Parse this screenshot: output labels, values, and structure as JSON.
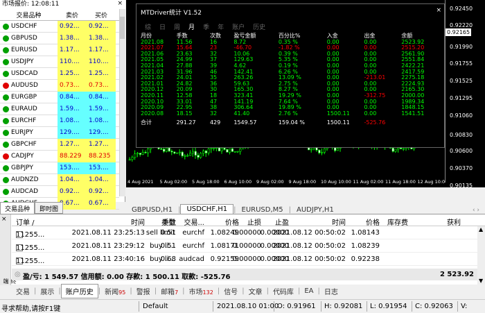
{
  "market_watch": {
    "title": "市场报价: 12:08:11",
    "close": "×",
    "columns": [
      "交易品种",
      "卖价",
      "买价"
    ],
    "rows": [
      {
        "symbol": "USDCHF",
        "bid": "0.92...",
        "ask": "0.92...",
        "bg": "#ffff66",
        "dir": "up"
      },
      {
        "symbol": "GBPUSD",
        "bid": "1.38...",
        "ask": "1.38...",
        "bg": "#ffff66",
        "dir": "up"
      },
      {
        "symbol": "EURUSD",
        "bid": "1.17...",
        "ask": "1.17...",
        "bg": "#ffff66",
        "dir": "up"
      },
      {
        "symbol": "USDJPY",
        "bid": "110....",
        "ask": "110....",
        "bg": "#ffff66",
        "dir": "up"
      },
      {
        "symbol": "USDCAD",
        "bid": "1.25...",
        "ask": "1.25...",
        "bg": "#ffff66",
        "dir": "up"
      },
      {
        "symbol": "AUDUSD",
        "bid": "0.73...",
        "ask": "0.73...",
        "bg": "#ffff66",
        "dir": "down"
      },
      {
        "symbol": "EURGBP",
        "bid": "0.84...",
        "ask": "0.84...",
        "bg": "#66ffff",
        "dir": "up"
      },
      {
        "symbol": "EURAUD",
        "bid": "1.59...",
        "ask": "1.59...",
        "bg": "#66ffff",
        "dir": "up"
      },
      {
        "symbol": "EURCHF",
        "bid": "1.08...",
        "ask": "1.08...",
        "bg": "#66ffff",
        "dir": "up"
      },
      {
        "symbol": "EURJPY",
        "bid": "129....",
        "ask": "129....",
        "bg": "#66ffff",
        "dir": "up"
      },
      {
        "symbol": "GBPCHF",
        "bid": "1.27...",
        "ask": "1.27...",
        "bg": "#ffff66",
        "dir": "up"
      },
      {
        "symbol": "CADJPY",
        "bid": "88.229",
        "ask": "88.235",
        "bg": "#ffff66",
        "dir": "down"
      },
      {
        "symbol": "GBPJPY",
        "bid": "153....",
        "ask": "153....",
        "bg": "#66ffff",
        "dir": "up"
      },
      {
        "symbol": "AUDNZD",
        "bid": "1.04...",
        "ask": "1.04...",
        "bg": "#ffff66",
        "dir": "up"
      },
      {
        "symbol": "AUDCAD",
        "bid": "0.92...",
        "ask": "0.92...",
        "bg": "#ffff66",
        "dir": "up"
      },
      {
        "symbol": "AUDCHF",
        "bid": "0.67...",
        "ask": "0.67...",
        "bg": "#ffff66",
        "dir": "up"
      }
    ],
    "tabs": [
      "交易品种",
      "即时图"
    ]
  },
  "indicator": {
    "title": "MTDriver统计 V1.52",
    "periods": [
      "综",
      "日",
      "周",
      "月",
      "季",
      "年",
      "账户",
      "历史"
    ],
    "active_period": "月",
    "columns": [
      "月份",
      "手数",
      "次数",
      "盈亏金额",
      "百分比%",
      "入金",
      "出金",
      "余额"
    ],
    "rows": [
      [
        "2021.08",
        "11.56",
        "16",
        "8.72",
        "0.35 %",
        "0.00",
        "0.00",
        "2523.92"
      ],
      [
        "2021.07",
        "15.64",
        "23",
        "-46.70",
        "-1.82 %",
        "0.00",
        "0.00",
        "2515.20"
      ],
      [
        "2021.06",
        "23.63",
        "32",
        "10.06",
        "0.39 %",
        "0.00",
        "0.00",
        "2561.90"
      ],
      [
        "2021.05",
        "24.99",
        "37",
        "129.63",
        "5.35 %",
        "0.00",
        "0.00",
        "2551.84"
      ],
      [
        "2021.04",
        "27.88",
        "39",
        "4.62",
        "0.19 %",
        "0.00",
        "0.00",
        "2422.21"
      ],
      [
        "2021.03",
        "31.96",
        "46",
        "142.41",
        "6.26 %",
        "0.00",
        "0.00",
        "2417.59"
      ],
      [
        "2021.02",
        "24.01",
        "35",
        "263.26",
        "13.09 %",
        "0.00",
        "-213.01",
        "2275.18"
      ],
      [
        "2021.01",
        "24.82",
        "36",
        "59.63",
        "2.75 %",
        "0.00",
        "0.00",
        "2224.93"
      ],
      [
        "2020.12",
        "20.09",
        "30",
        "165.30",
        "8.27 %",
        "0.00",
        "0.00",
        "2165.30"
      ],
      [
        "2020.11",
        "12.58",
        "18",
        "323.41",
        "19.29 %",
        "0.00",
        "-312.75",
        "2000.00"
      ],
      [
        "2020.10",
        "33.01",
        "47",
        "141.19",
        "7.64 %",
        "0.00",
        "0.00",
        "1989.34"
      ],
      [
        "2020.09",
        "22.95",
        "38",
        "306.64",
        "19.89 %",
        "0.00",
        "0.00",
        "1848.15"
      ],
      [
        "2020.08",
        "18.15",
        "32",
        "41.40",
        "2.76 %",
        "1500.11",
        "0.00",
        "1541.51"
      ]
    ],
    "total": [
      "合计",
      "291.27",
      "429",
      "1549.57",
      "159.04 %",
      "1500.11",
      "-525.76",
      ""
    ]
  },
  "price_axis": [
    "0.92450",
    "0.92220",
    "0.92165",
    "0.91990",
    "0.91755",
    "0.91525",
    "0.91295",
    "0.91060",
    "0.90830",
    "0.90600",
    "0.90370",
    "0.90135"
  ],
  "time_axis": [
    "4 Aug 2021",
    "5 Aug 02:00",
    "5 Aug 18:00",
    "6 Aug 10:00",
    "9 Aug 02:00",
    "9 Aug 18:00",
    "10 Aug 10:00",
    "11 Aug 02:00",
    "11 Aug 18:00",
    "12 Aug 10:00"
  ],
  "chart_tabs": [
    "GBPUSD,H1",
    "USDCHF,H1",
    "EURUSD,M5",
    "AUDJPY,H1"
  ],
  "active_chart_tab": "USDCHF,H1",
  "terminal": {
    "columns": [
      "订单 /",
      "时间",
      "类型",
      "手数",
      "交易...",
      "价格",
      "止损",
      "止盈",
      "时间",
      "价格",
      "库存费",
      "获利"
    ],
    "rows": [
      [
        "11255...",
        "2021.08.11 23:25:13",
        "sell limit",
        "0.51",
        "eurchf",
        "1.08249",
        "0.00000",
        "0.00000",
        "2021.08.12 00:50:02",
        "1.08143",
        "",
        ""
      ],
      [
        "11255...",
        "2021.08.11 23:29:12",
        "buy li...",
        "0.51",
        "eurchf",
        "1.08171",
        "0.00000",
        "0.00000",
        "2021.08.12 00:50:02",
        "1.08239",
        "",
        ""
      ],
      [
        "11255...",
        "2021.08.11 23:40:16",
        "buy li...",
        "0.68",
        "audcad",
        "0.92159",
        "0.00000",
        "0.00000",
        "2021.08.12 00:50:02",
        "0.92238",
        "",
        ""
      ]
    ],
    "summary": "盈/亏: 1 549.57 信用额: 0.00 存款: 1 500.11 取款: -525.76",
    "summary_total": "2 523.92",
    "side_label": "终端"
  },
  "bottom_tabs": [
    {
      "label": "交易",
      "badge": ""
    },
    {
      "label": "展示",
      "badge": ""
    },
    {
      "label": "账户历史",
      "badge": ""
    },
    {
      "label": "新闻",
      "badge": "95"
    },
    {
      "label": "警报",
      "badge": ""
    },
    {
      "label": "邮箱",
      "badge": "7"
    },
    {
      "label": "市场",
      "badge": "132"
    },
    {
      "label": "信号",
      "badge": ""
    },
    {
      "label": "文章",
      "badge": ""
    },
    {
      "label": "代码库",
      "badge": ""
    },
    {
      "label": "EA",
      "badge": ""
    },
    {
      "label": "日志",
      "badge": ""
    }
  ],
  "active_bottom_tab": "账户历史",
  "status": {
    "help": "寻求帮助,请按F1键",
    "profile": "Default",
    "time": "2021.08.10 01:00",
    "open": "O: 0.91961",
    "high": "H: 0.92081",
    "low": "L: 0.91954",
    "close": "C: 0.92063",
    "volume": "V:"
  },
  "colors": {
    "up": "#00a000",
    "down": "#e00000",
    "yellow_row": "#ffff66",
    "cyan_row": "#66ffff",
    "ind_green": "#00ff00",
    "ind_red": "#ff0000"
  }
}
